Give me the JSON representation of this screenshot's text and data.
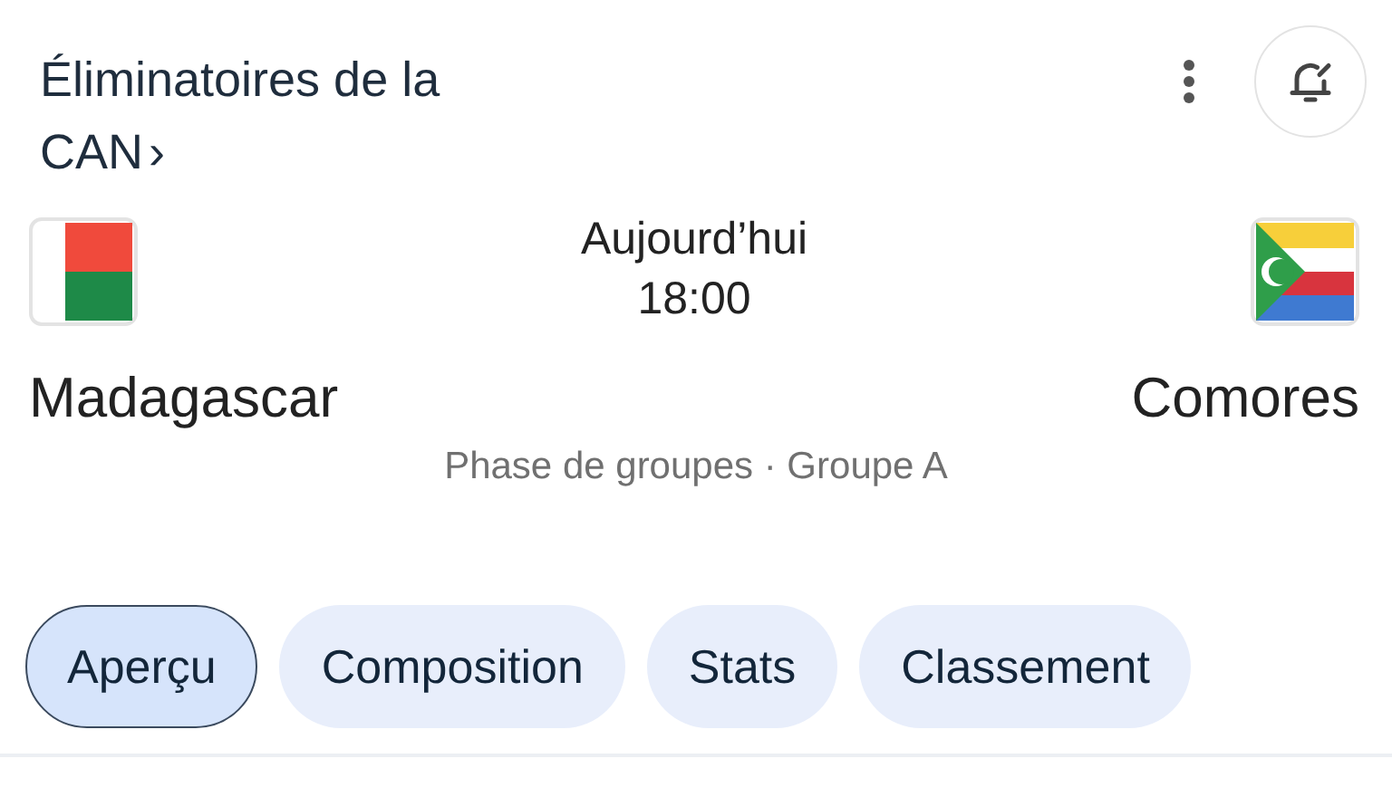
{
  "competition": {
    "title": "Éliminatoires de la CAN",
    "chevron": "›"
  },
  "match": {
    "status": "Aujourd’hui",
    "time": "18:00",
    "stage": "Phase de groupes · Groupe A"
  },
  "teams": [
    {
      "name": "Madagascar",
      "kind": "madagascar"
    },
    {
      "name": "Comores",
      "kind": "comoros"
    }
  ],
  "tabs": [
    {
      "label": "Aperçu",
      "selected": true
    },
    {
      "label": "Composition",
      "selected": false
    },
    {
      "label": "Stats",
      "selected": false
    },
    {
      "label": "Classement",
      "selected": false
    }
  ]
}
